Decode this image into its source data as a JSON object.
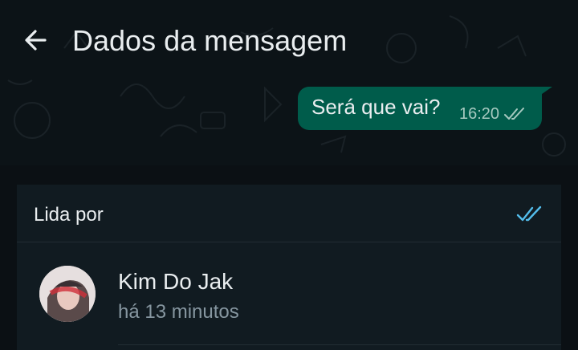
{
  "header": {
    "title": "Dados da mensagem",
    "back_icon": "arrow-left-icon"
  },
  "message": {
    "text": "Será que vai?",
    "time": "16:20",
    "status_icon": "double-check-icon"
  },
  "read_section": {
    "label": "Lida por",
    "status_icon": "double-check-blue-icon"
  },
  "readers": [
    {
      "name": "Kim Do Jak",
      "time": "há 13 minutos",
      "avatar_icon": "avatar-icon"
    }
  ],
  "colors": {
    "background": "#0b1014",
    "bubble": "#005c4b",
    "panel": "#111b21",
    "read_check": "#53bdeb",
    "text_primary": "#e9edef",
    "text_secondary": "#8696a0"
  }
}
